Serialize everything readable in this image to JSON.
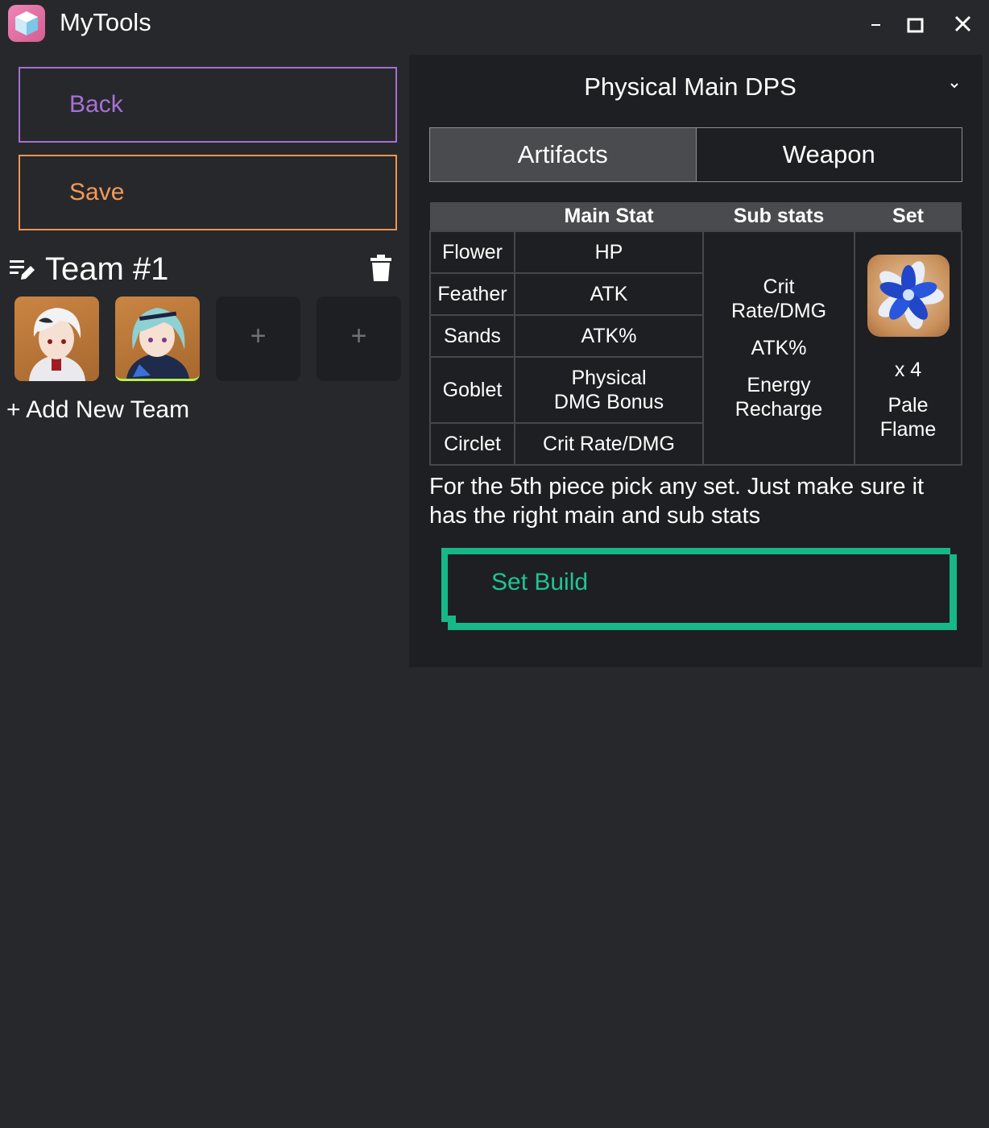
{
  "window": {
    "title": "MyTools",
    "icons": {
      "app": "cube-app-icon",
      "minimize": "minimize-icon",
      "maximize": "maximize-icon",
      "close": "close-icon"
    }
  },
  "sidebar": {
    "back_label": "Back",
    "save_label": "Save",
    "back_color": "#a970d6",
    "save_color": "#f29a57",
    "team": {
      "name": "Team #1",
      "slots": [
        {
          "type": "character",
          "icon": "character-portrait-white-hair"
        },
        {
          "type": "character",
          "icon": "character-portrait-teal-hair",
          "selected": true
        },
        {
          "type": "empty",
          "label": "+"
        },
        {
          "type": "empty",
          "label": "+"
        }
      ]
    },
    "add_team_label": "+ Add New Team"
  },
  "build": {
    "title": "Physical Main DPS",
    "tabs": [
      {
        "label": "Artifacts",
        "active": true
      },
      {
        "label": "Weapon",
        "active": false
      }
    ],
    "table": {
      "headers": [
        "",
        "Main Stat",
        "Sub stats",
        "Set"
      ],
      "rows": [
        {
          "slot": "Flower",
          "main": "HP"
        },
        {
          "slot": "Feather",
          "main": "ATK"
        },
        {
          "slot": "Sands",
          "main": "ATK%"
        },
        {
          "slot": "Goblet",
          "main": "Physical DMG Bonus"
        },
        {
          "slot": "Circlet",
          "main": "Crit Rate/DMG"
        }
      ],
      "sub_stats": [
        "Crit Rate/DMG",
        "ATK%",
        "Energy Recharge"
      ],
      "set": {
        "count": "x 4",
        "name": "Pale Flame",
        "icon": "pale-flame-flower-icon"
      }
    },
    "hint": "For the 5th piece pick any set. Just make sure it has the right main and sub stats",
    "set_build_label": "Set Build",
    "accent_color": "#17b888"
  }
}
